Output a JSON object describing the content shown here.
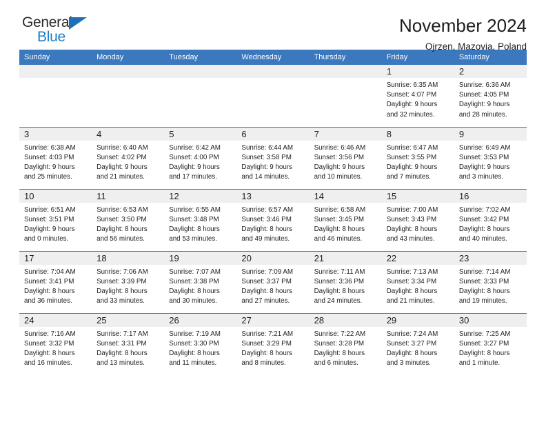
{
  "brand": {
    "name_top": "General",
    "name_bottom": "Blue",
    "triangle_color": "#1f6fb8",
    "blue_text_color": "#1f7fc4"
  },
  "header": {
    "title": "November 2024",
    "subtitle": "Ojrzen, Mazovia, Poland"
  },
  "theme": {
    "header_blue": "#3b78be",
    "daynum_band": "#efefef",
    "text": "#1d1d1d"
  },
  "weekdays": [
    "Sunday",
    "Monday",
    "Tuesday",
    "Wednesday",
    "Thursday",
    "Friday",
    "Saturday"
  ],
  "weeks": [
    [
      {
        "day": "",
        "sunrise": "",
        "sunset": "",
        "daylight1": "",
        "daylight2": ""
      },
      {
        "day": "",
        "sunrise": "",
        "sunset": "",
        "daylight1": "",
        "daylight2": ""
      },
      {
        "day": "",
        "sunrise": "",
        "sunset": "",
        "daylight1": "",
        "daylight2": ""
      },
      {
        "day": "",
        "sunrise": "",
        "sunset": "",
        "daylight1": "",
        "daylight2": ""
      },
      {
        "day": "",
        "sunrise": "",
        "sunset": "",
        "daylight1": "",
        "daylight2": ""
      },
      {
        "day": "1",
        "sunrise": "Sunrise: 6:35 AM",
        "sunset": "Sunset: 4:07 PM",
        "daylight1": "Daylight: 9 hours",
        "daylight2": "and 32 minutes."
      },
      {
        "day": "2",
        "sunrise": "Sunrise: 6:36 AM",
        "sunset": "Sunset: 4:05 PM",
        "daylight1": "Daylight: 9 hours",
        "daylight2": "and 28 minutes."
      }
    ],
    [
      {
        "day": "3",
        "sunrise": "Sunrise: 6:38 AM",
        "sunset": "Sunset: 4:03 PM",
        "daylight1": "Daylight: 9 hours",
        "daylight2": "and 25 minutes."
      },
      {
        "day": "4",
        "sunrise": "Sunrise: 6:40 AM",
        "sunset": "Sunset: 4:02 PM",
        "daylight1": "Daylight: 9 hours",
        "daylight2": "and 21 minutes."
      },
      {
        "day": "5",
        "sunrise": "Sunrise: 6:42 AM",
        "sunset": "Sunset: 4:00 PM",
        "daylight1": "Daylight: 9 hours",
        "daylight2": "and 17 minutes."
      },
      {
        "day": "6",
        "sunrise": "Sunrise: 6:44 AM",
        "sunset": "Sunset: 3:58 PM",
        "daylight1": "Daylight: 9 hours",
        "daylight2": "and 14 minutes."
      },
      {
        "day": "7",
        "sunrise": "Sunrise: 6:46 AM",
        "sunset": "Sunset: 3:56 PM",
        "daylight1": "Daylight: 9 hours",
        "daylight2": "and 10 minutes."
      },
      {
        "day": "8",
        "sunrise": "Sunrise: 6:47 AM",
        "sunset": "Sunset: 3:55 PM",
        "daylight1": "Daylight: 9 hours",
        "daylight2": "and 7 minutes."
      },
      {
        "day": "9",
        "sunrise": "Sunrise: 6:49 AM",
        "sunset": "Sunset: 3:53 PM",
        "daylight1": "Daylight: 9 hours",
        "daylight2": "and 3 minutes."
      }
    ],
    [
      {
        "day": "10",
        "sunrise": "Sunrise: 6:51 AM",
        "sunset": "Sunset: 3:51 PM",
        "daylight1": "Daylight: 9 hours",
        "daylight2": "and 0 minutes."
      },
      {
        "day": "11",
        "sunrise": "Sunrise: 6:53 AM",
        "sunset": "Sunset: 3:50 PM",
        "daylight1": "Daylight: 8 hours",
        "daylight2": "and 56 minutes."
      },
      {
        "day": "12",
        "sunrise": "Sunrise: 6:55 AM",
        "sunset": "Sunset: 3:48 PM",
        "daylight1": "Daylight: 8 hours",
        "daylight2": "and 53 minutes."
      },
      {
        "day": "13",
        "sunrise": "Sunrise: 6:57 AM",
        "sunset": "Sunset: 3:46 PM",
        "daylight1": "Daylight: 8 hours",
        "daylight2": "and 49 minutes."
      },
      {
        "day": "14",
        "sunrise": "Sunrise: 6:58 AM",
        "sunset": "Sunset: 3:45 PM",
        "daylight1": "Daylight: 8 hours",
        "daylight2": "and 46 minutes."
      },
      {
        "day": "15",
        "sunrise": "Sunrise: 7:00 AM",
        "sunset": "Sunset: 3:43 PM",
        "daylight1": "Daylight: 8 hours",
        "daylight2": "and 43 minutes."
      },
      {
        "day": "16",
        "sunrise": "Sunrise: 7:02 AM",
        "sunset": "Sunset: 3:42 PM",
        "daylight1": "Daylight: 8 hours",
        "daylight2": "and 40 minutes."
      }
    ],
    [
      {
        "day": "17",
        "sunrise": "Sunrise: 7:04 AM",
        "sunset": "Sunset: 3:41 PM",
        "daylight1": "Daylight: 8 hours",
        "daylight2": "and 36 minutes."
      },
      {
        "day": "18",
        "sunrise": "Sunrise: 7:06 AM",
        "sunset": "Sunset: 3:39 PM",
        "daylight1": "Daylight: 8 hours",
        "daylight2": "and 33 minutes."
      },
      {
        "day": "19",
        "sunrise": "Sunrise: 7:07 AM",
        "sunset": "Sunset: 3:38 PM",
        "daylight1": "Daylight: 8 hours",
        "daylight2": "and 30 minutes."
      },
      {
        "day": "20",
        "sunrise": "Sunrise: 7:09 AM",
        "sunset": "Sunset: 3:37 PM",
        "daylight1": "Daylight: 8 hours",
        "daylight2": "and 27 minutes."
      },
      {
        "day": "21",
        "sunrise": "Sunrise: 7:11 AM",
        "sunset": "Sunset: 3:36 PM",
        "daylight1": "Daylight: 8 hours",
        "daylight2": "and 24 minutes."
      },
      {
        "day": "22",
        "sunrise": "Sunrise: 7:13 AM",
        "sunset": "Sunset: 3:34 PM",
        "daylight1": "Daylight: 8 hours",
        "daylight2": "and 21 minutes."
      },
      {
        "day": "23",
        "sunrise": "Sunrise: 7:14 AM",
        "sunset": "Sunset: 3:33 PM",
        "daylight1": "Daylight: 8 hours",
        "daylight2": "and 19 minutes."
      }
    ],
    [
      {
        "day": "24",
        "sunrise": "Sunrise: 7:16 AM",
        "sunset": "Sunset: 3:32 PM",
        "daylight1": "Daylight: 8 hours",
        "daylight2": "and 16 minutes."
      },
      {
        "day": "25",
        "sunrise": "Sunrise: 7:17 AM",
        "sunset": "Sunset: 3:31 PM",
        "daylight1": "Daylight: 8 hours",
        "daylight2": "and 13 minutes."
      },
      {
        "day": "26",
        "sunrise": "Sunrise: 7:19 AM",
        "sunset": "Sunset: 3:30 PM",
        "daylight1": "Daylight: 8 hours",
        "daylight2": "and 11 minutes."
      },
      {
        "day": "27",
        "sunrise": "Sunrise: 7:21 AM",
        "sunset": "Sunset: 3:29 PM",
        "daylight1": "Daylight: 8 hours",
        "daylight2": "and 8 minutes."
      },
      {
        "day": "28",
        "sunrise": "Sunrise: 7:22 AM",
        "sunset": "Sunset: 3:28 PM",
        "daylight1": "Daylight: 8 hours",
        "daylight2": "and 6 minutes."
      },
      {
        "day": "29",
        "sunrise": "Sunrise: 7:24 AM",
        "sunset": "Sunset: 3:27 PM",
        "daylight1": "Daylight: 8 hours",
        "daylight2": "and 3 minutes."
      },
      {
        "day": "30",
        "sunrise": "Sunrise: 7:25 AM",
        "sunset": "Sunset: 3:27 PM",
        "daylight1": "Daylight: 8 hours",
        "daylight2": "and 1 minute."
      }
    ]
  ]
}
